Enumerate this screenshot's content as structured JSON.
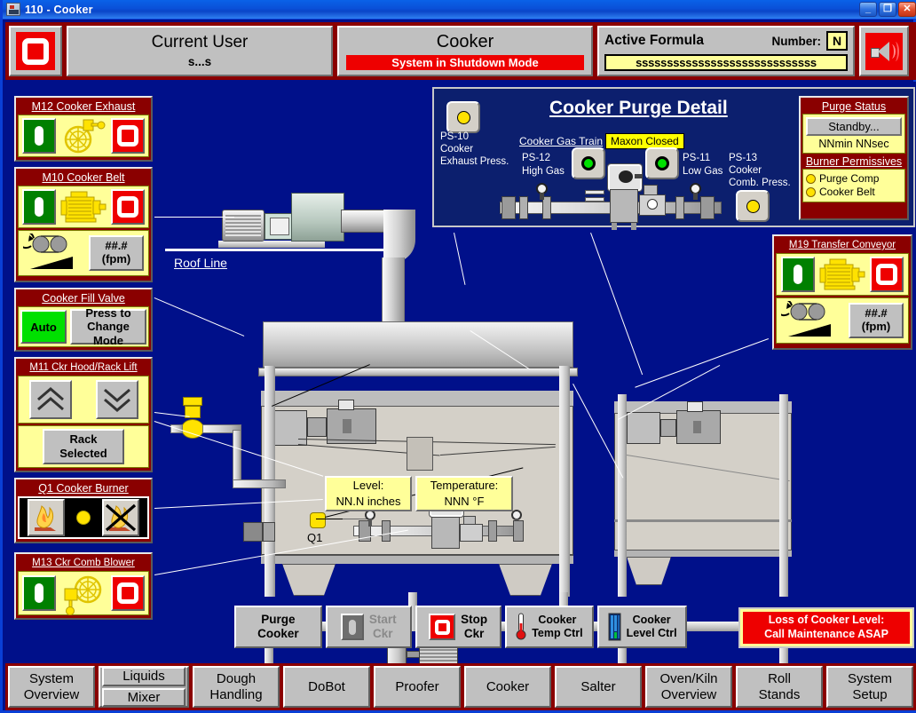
{
  "window": {
    "title": "110 - Cooker",
    "title_id": "110",
    "minimize": "_",
    "maximize": "❐",
    "close": "✕",
    "icon": "hmi-window-icon"
  },
  "header": {
    "logo_name": "stop-logo-button",
    "user": {
      "label": "Current User",
      "value": "s...s"
    },
    "screen": {
      "title": "Cooker",
      "status": "System in Shutdown Mode"
    },
    "formula": {
      "label": "Active Formula",
      "number_label": "Number:",
      "number_value": "N",
      "name_value": "sssssssssssssssssssssssssssss"
    },
    "horn": "silence-horn-button"
  },
  "left_panels": [
    {
      "id": "m12-cooker-exhaust",
      "title": "M12 Cooker Exhaust",
      "start": "start",
      "stop": "stop",
      "device_icon": "fan-icon"
    },
    {
      "id": "m10-cooker-belt",
      "title": "M10 Cooker Belt",
      "start": "start",
      "stop": "stop",
      "device_icon": "motor-icon",
      "speed_value": "##.#",
      "speed_units": "(fpm)"
    },
    {
      "id": "cooker-fill-valve",
      "title": "Cooker Fill Valve",
      "mode_value": "Auto",
      "mode_button_line1": "Press to",
      "mode_button_line2": "Change Mode"
    },
    {
      "id": "m11-ckr-hood-rack-lift",
      "title": "M11 Ckr Hood/Rack Lift",
      "raise_icon": "double-chevron-up-icon",
      "lower_icon": "double-chevron-down-icon",
      "select_line1": "Rack",
      "select_line2": "Selected"
    },
    {
      "id": "q1-cooker-burner",
      "title": "Q1 Cooker Burner",
      "burner_on_icon": "burner-flame-on-icon",
      "burner_off_icon": "burner-flame-off-icon",
      "status_lamp": "burner-status-lamp"
    },
    {
      "id": "m13-ckr-comb-blower",
      "title": "M13 Ckr Comb Blower",
      "start": "start",
      "stop": "stop",
      "device_icon": "blower-icon"
    }
  ],
  "right_panel": {
    "id": "m19-transfer-conveyor",
    "title": "M19 Transfer Conveyor",
    "start": "start",
    "stop": "stop",
    "device_icon": "motor-icon",
    "speed_value": "##.#",
    "speed_units": "(fpm)"
  },
  "purge_detail": {
    "title": "Cooker Purge Detail",
    "ps10": {
      "tag": "PS-10",
      "line1": "Cooker",
      "line2": "Exhaust Press.",
      "lamp": "yellow"
    },
    "gas_train_label": "Cooker Gas Train",
    "ps12": {
      "tag": "PS-12",
      "line1": "High Gas",
      "lamp": "green"
    },
    "ps11": {
      "tag": "PS-11",
      "line1": "Low Gas",
      "lamp": "green"
    },
    "ps13": {
      "tag": "PS-13",
      "line1": "Cooker",
      "line2": "Comb. Press.",
      "lamp": "yellow"
    },
    "maxon_tag": "Maxon Closed",
    "status": {
      "heading": "Purge Status",
      "state": "Standby...",
      "timer": "NNmin NNsec"
    },
    "permissives": {
      "heading": "Burner Permissives",
      "items": [
        {
          "label": "Purge Comp",
          "lamp": "yellow"
        },
        {
          "label": "Cooker Belt",
          "lamp": "yellow"
        }
      ]
    }
  },
  "diagram": {
    "roof_line_label": "Roof Line",
    "burner_tag": "Q1",
    "level_readout": {
      "label": "Level:",
      "value": "NN.N  inches"
    },
    "temp_readout": {
      "label": "Temperature:",
      "value": "NNN  °F"
    }
  },
  "actions": [
    {
      "id": "purge-cooker",
      "line1": "Purge",
      "line2": "Cooker",
      "icon": "none",
      "disabled": false
    },
    {
      "id": "start-ckr",
      "line1": "Start",
      "line2": "Ckr",
      "icon": "start-icon",
      "disabled": true
    },
    {
      "id": "stop-ckr",
      "line1": "Stop",
      "line2": "Ckr",
      "icon": "stop-icon",
      "disabled": false
    },
    {
      "id": "cooker-temp-ctrl",
      "line1": "Cooker",
      "line2": "Temp Ctrl",
      "icon": "thermometer-icon",
      "disabled": false
    },
    {
      "id": "cooker-level-ctrl",
      "line1": "Cooker",
      "line2": "Level Ctrl",
      "icon": "level-gauge-icon",
      "disabled": false
    }
  ],
  "alarm": {
    "line1": "Loss of Cooker Level:",
    "line2": "Call Maintenance ASAP"
  },
  "nav": [
    {
      "id": "system-overview",
      "line1": "System",
      "line2": "Overview",
      "split": false
    },
    {
      "id": "liquids-mixer",
      "line1": "Liquids",
      "line2": "Mixer",
      "split": true
    },
    {
      "id": "dough-handling",
      "line1": "Dough",
      "line2": "Handling",
      "split": false
    },
    {
      "id": "dobot",
      "line1": "DoBot",
      "line2": "",
      "split": false
    },
    {
      "id": "proofer",
      "line1": "Proofer",
      "line2": "",
      "split": false
    },
    {
      "id": "cooker",
      "line1": "Cooker",
      "line2": "",
      "split": false
    },
    {
      "id": "salter",
      "line1": "Salter",
      "line2": "",
      "split": false
    },
    {
      "id": "oven-kiln-overview",
      "line1": "Oven/Kiln",
      "line2": "Overview",
      "split": false
    },
    {
      "id": "roll-stands",
      "line1": "Roll",
      "line2": "Stands",
      "split": false
    },
    {
      "id": "system-setup",
      "line1": "System",
      "line2": "Setup",
      "split": false
    }
  ],
  "colors": {
    "window_blue": "#0a50d8",
    "screen_bg": "#00108a",
    "panel_frame": "#8a0000",
    "panel_body": "#ffff99",
    "start_green": "#008000",
    "stop_red": "#ee0000",
    "lamp_yellow": "#ffe200",
    "lamp_green": "#00e000",
    "face_grey": "#c0c0c0"
  }
}
